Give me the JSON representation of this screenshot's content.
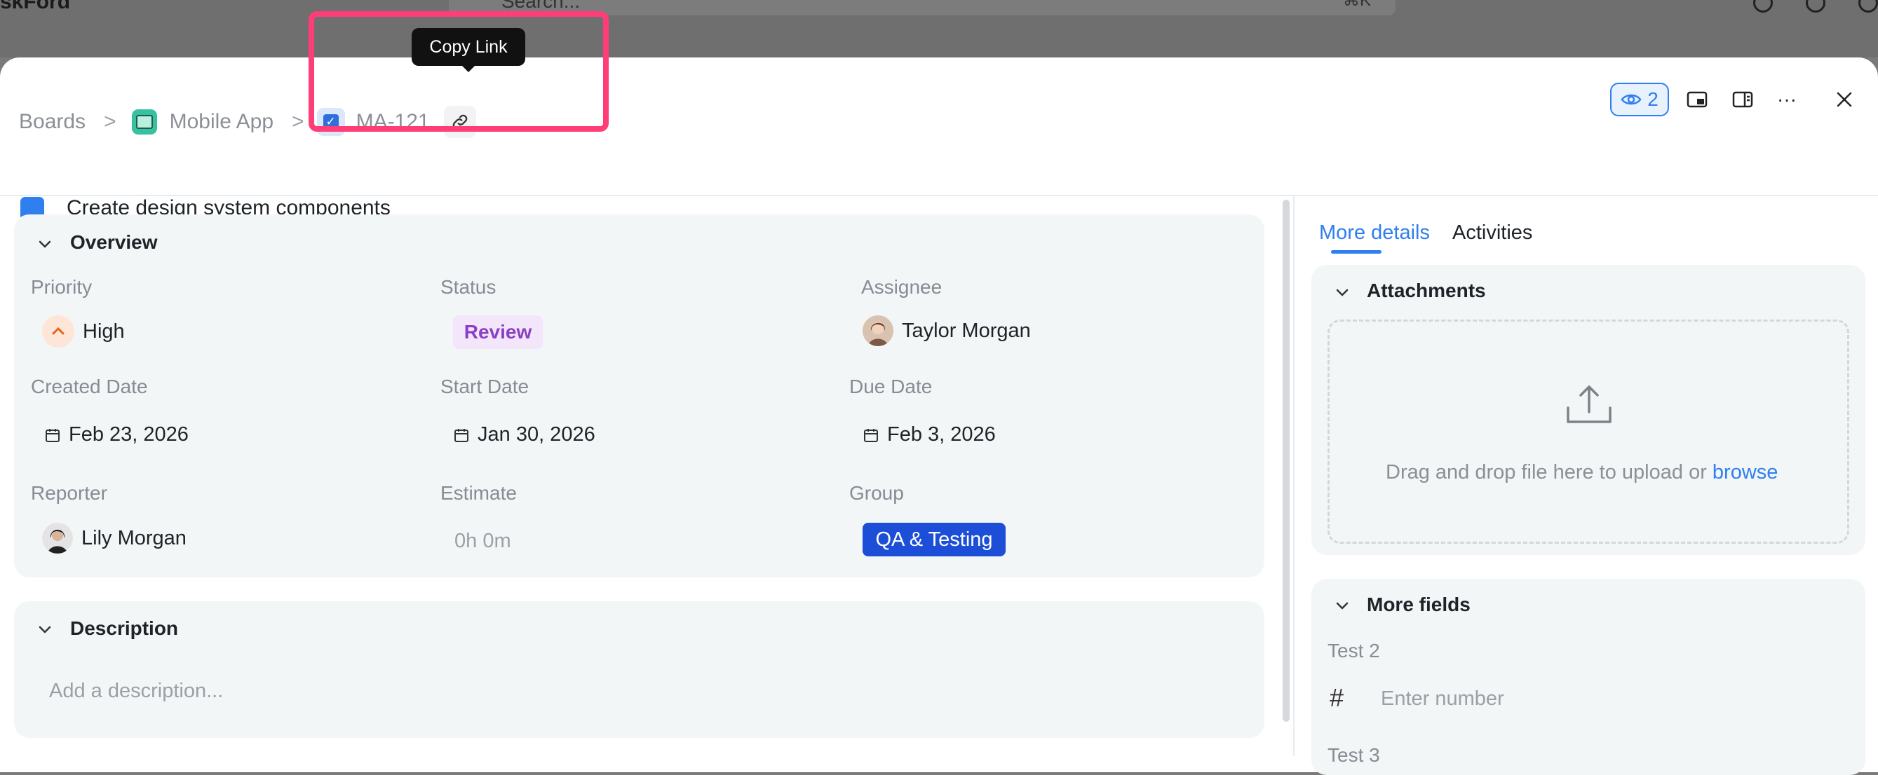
{
  "background": {
    "workspace": "skFord",
    "search_placeholder": "Search...",
    "shortcut": "⌘K"
  },
  "breadcrumb": {
    "boards": "Boards",
    "project": "Mobile App",
    "issue_key": "MA-121",
    "separator": ">"
  },
  "tooltip": {
    "text": "Copy Link"
  },
  "title": "Create design system components",
  "watchers": {
    "count": "2"
  },
  "overview": {
    "section_title": "Overview",
    "priority": {
      "label": "Priority",
      "value": "High"
    },
    "status": {
      "label": "Status",
      "value": "Review"
    },
    "assignee": {
      "label": "Assignee",
      "value": "Taylor Morgan"
    },
    "created": {
      "label": "Created Date",
      "value": "Feb 23, 2026"
    },
    "start": {
      "label": "Start Date",
      "value": "Jan 30, 2026"
    },
    "due": {
      "label": "Due Date",
      "value": "Feb 3, 2026"
    },
    "reporter": {
      "label": "Reporter",
      "value": "Lily Morgan"
    },
    "estimate": {
      "label": "Estimate",
      "value": "0h 0m"
    },
    "group": {
      "label": "Group",
      "value": "QA & Testing"
    }
  },
  "description": {
    "section_title": "Description",
    "placeholder": "Add a description..."
  },
  "right": {
    "tabs": [
      {
        "label": "More details"
      },
      {
        "label": "Activities"
      }
    ],
    "attachments": {
      "title": "Attachments",
      "drop_text": "Drag and drop file here to upload or",
      "browse": "browse"
    },
    "more_fields": {
      "title": "More fields",
      "test2_label": "Test 2",
      "number_placeholder": "Enter number",
      "test3_label": "Test 3"
    }
  },
  "colors": {
    "accent": "#2f7fef",
    "highlight": "#ff3d77",
    "status_review": "#8b3fc4",
    "group_badge": "#1d4ed8"
  }
}
